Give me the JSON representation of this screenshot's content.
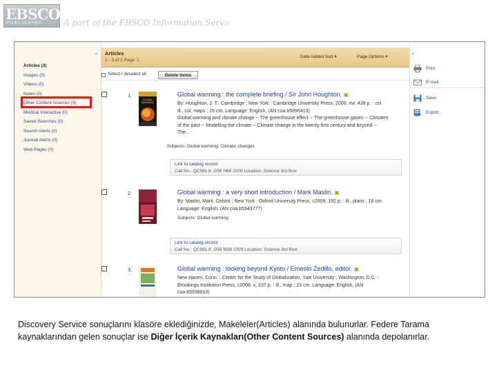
{
  "header": {
    "logo_text": "EBSCO",
    "logo_subtext": "PUBLISHING",
    "tagline": "A part of the EBSCO Information Services"
  },
  "left_panel": {
    "collapse_glyph": "«",
    "folders": [
      {
        "label": "Articles (3)",
        "active": true
      },
      {
        "label": "Images (0)"
      },
      {
        "label": "Videos (0)"
      },
      {
        "label": "Notes (0)"
      },
      {
        "label": "Other Content Sources (3)"
      },
      {
        "label": "Medical Interactive (0)"
      },
      {
        "label": "Saved Searches (0)"
      },
      {
        "label": "Search Alerts (0)"
      },
      {
        "label": "Journal Alerts (0)"
      },
      {
        "label": "Web Pages (0)"
      }
    ]
  },
  "center": {
    "title": "Articles",
    "subtitle": "1 - 3 of 3  Page: 1",
    "sort_label": "Date Added Sort ▾",
    "page_options_label": "Page Options ▾",
    "select_label": "Select / deselect all",
    "delete_button": "Delete Items",
    "records": [
      {
        "num": "1.",
        "title": "Global warming : the complete briefing / Sir John Houghton.",
        "meta": [
          "By: Houghton, J. T.. Cambridge ; New York : Cambridge University Press, 2009. xvi, 438 p. : col.",
          "ill., col. maps ; 25 cm. Language: English, (AN cua.b5896413)",
          "Global warming and climate change -- The greenhouse effect -- The greenhouse gases -- Climates",
          "of the past -- Modelling the climate -- Climate change in the twenty-first century and beyond --",
          "The..."
        ],
        "subjects": "Subjects: Global warming; Climatic changes",
        "link": "Link to catalog record",
        "callno": "Call No.: QC981.8 .G56 H68 2009    Location: Science 3rd floor"
      },
      {
        "num": "2.",
        "title": "Global warming : a very short introduction / Mark Maslin.",
        "meta": [
          "By: Maslin, Mark. Oxford ; New York : Oxford University Press, c2009. 192 p. : ill., plans ; 18 cm.",
          "Language: English, (AN cua.b5943777)"
        ],
        "subjects": "Subjects: Global warming",
        "link": "Link to catalog record",
        "callno": "Call No.: QC981.8 .G56 M38 2009    Location: Science 3rd floor"
      },
      {
        "num": "3.",
        "title": "Global warming : looking beyond Kyoto / Ernesto Zedillo, editor.",
        "meta": [
          "New Haven, Conn. : Center for the Study of Globalization, Yale University ; Washington, D.C. :",
          "Brookings Institution Press, c2008. x, 237 p. : ill., map ; 23 cm. Language: English, (AN",
          "cua.b5938810)"
        ]
      }
    ]
  },
  "right_panel": {
    "collapse_glyph": "»",
    "tools": [
      {
        "label": "Print",
        "icon": "printer-icon"
      },
      {
        "label": "E-mail",
        "icon": "envelope-icon"
      },
      {
        "label": "Save",
        "icon": "floppy-disk-icon"
      },
      {
        "label": "Export",
        "icon": "export-icon"
      }
    ]
  },
  "caption": {
    "before": "Discovery Service sonuçlarını klasöre eklediğinizde, Makeleler(Articles) alanında bulunurlar. Federe Tarama kaynaklarından gelen sonuçlar ise ",
    "bold": "Diğer İçerik Kaynakları(Other Content Sources)",
    "after": " alanında depolanırlar."
  },
  "colors": {
    "highlight_box": "#d51e1e",
    "panel_header": "#e8c889",
    "link": "#1a3e9c"
  }
}
